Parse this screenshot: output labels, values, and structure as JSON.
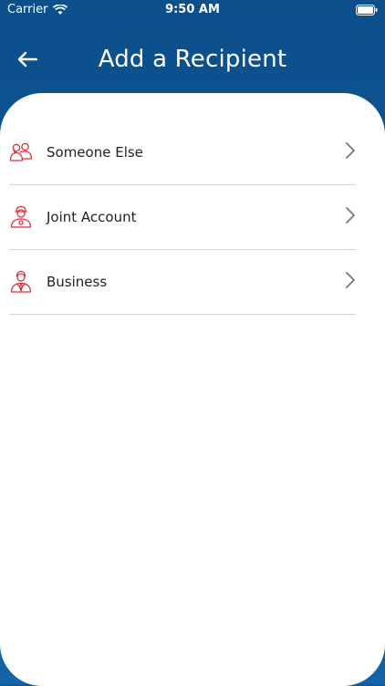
{
  "status_bar": {
    "carrier": "Carrier",
    "time": "9:50 AM",
    "wifi_icon": "wifi-icon",
    "battery_icon": "battery-icon"
  },
  "header": {
    "title": "Add a Recipient",
    "back_icon": "arrow-left-icon"
  },
  "colors": {
    "header_bg_top": "#0b4f8b",
    "header_bg_bottom": "#1263a7",
    "icon_accent": "#d8323f",
    "chevron": "#777777",
    "divider": "#d6d6d6"
  },
  "recipients": [
    {
      "label": "Someone Else",
      "icon": "group-people-icon"
    },
    {
      "label": "Joint Account",
      "icon": "joint-account-person-icon"
    },
    {
      "label": "Business",
      "icon": "business-person-icon"
    }
  ]
}
